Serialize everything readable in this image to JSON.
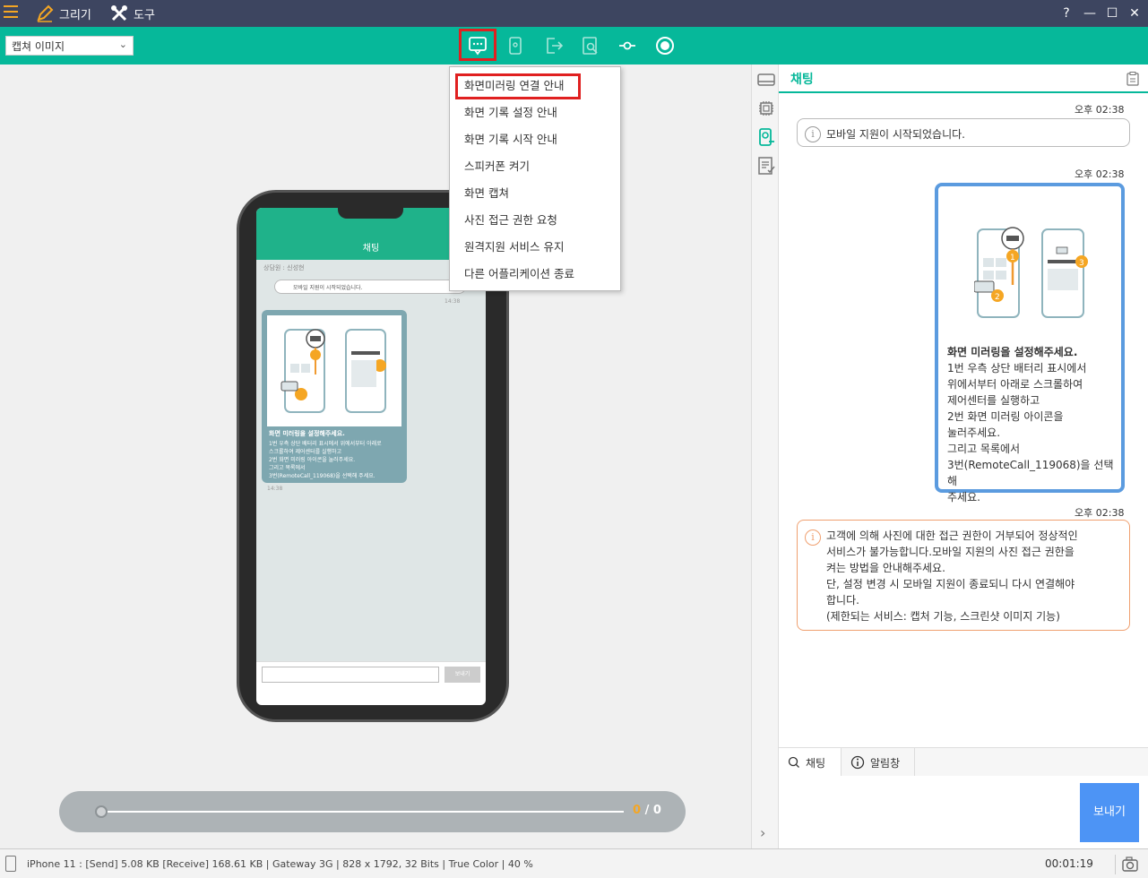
{
  "titlebar": {
    "draw_label": "그리기",
    "tools_label": "도구",
    "help": "?",
    "minimize": "—",
    "maximize": "☐",
    "close": "✕"
  },
  "toolbar": {
    "capture_select_value": "캡쳐 이미지"
  },
  "dropdown": {
    "items": [
      "화면미러링 연결 안내",
      "화면 기록 설정 안내",
      "화면 기록 시작 안내",
      "스피커폰 켜기",
      "화면 캡쳐",
      "사진 접근 권한 요청",
      "원격지원 서비스 유지",
      "다른 어플리케이션 종료"
    ]
  },
  "phone": {
    "header_title": "채팅",
    "counselor": "상담원 : 신성현",
    "sys_msg": "모바일 지원이 시작되었습니다.",
    "time1": "14:38",
    "bubble_title": "화면 미러링을 설정해주세요.",
    "bubble_lines": [
      "1번 우측 상단 배터리 표시에서 위에서부터 아래로",
      "스크롤하여 제어센터를 실행하고",
      "2번 화면 미러링 아이콘을 눌러주세요.",
      "그리고 목록에서",
      "3번(RemoteCall_119068)을 선택해 주세요."
    ],
    "time2": "14:38",
    "send_label": "보내기"
  },
  "progress": {
    "current": "0",
    "separator": "/",
    "total": "0"
  },
  "chat": {
    "title": "채팅",
    "time1": "오후 02:38",
    "sys_msg": "모바일 지원이 시작되었습니다.",
    "time2": "오후 02:38",
    "bubble_title": "화면 미러링을 설정해주세요.",
    "bubble_lines": [
      "1번 우측 상단 배터리 표시에서",
      "위에서부터 아래로 스크롤하여",
      "제어센터를 실행하고",
      "2번 화면 미러링 아이콘을",
      "눌러주세요.",
      "그리고 목록에서",
      "3번(RemoteCall_119068)을 선택해",
      "주세요."
    ],
    "time3": "오후 02:38",
    "warn_lines": [
      "고객에 의해 사진에 대한 접근 권한이 거부되어 정상적인",
      "서비스가 불가능합니다.모바일 지원의 사진 접근 권한을",
      "켜는 방법을 안내해주세요.",
      "단, 설정 변경 시 모바일 지원이 종료되니 다시 연결해야",
      "합니다.",
      "(제한되는 서비스: 캡처 기능, 스크린샷 이미지 기능)"
    ],
    "tab_chat": "채팅",
    "tab_notice": "알림창",
    "send_label": "보내기"
  },
  "status": {
    "text": "iPhone 11 : [Send] 5.08 KB  [Receive] 168.61 KB | Gateway 3G | 828 x 1792, 32 Bits | True Color | 40 %",
    "timer": "00:01:19"
  },
  "colors": {
    "accent": "#06b89a",
    "titlebar": "#3d4560",
    "highlight": "#e02020",
    "bubble_border": "#5b9bdf",
    "warn_border": "#f0a070",
    "send_button": "#4d94f5"
  }
}
